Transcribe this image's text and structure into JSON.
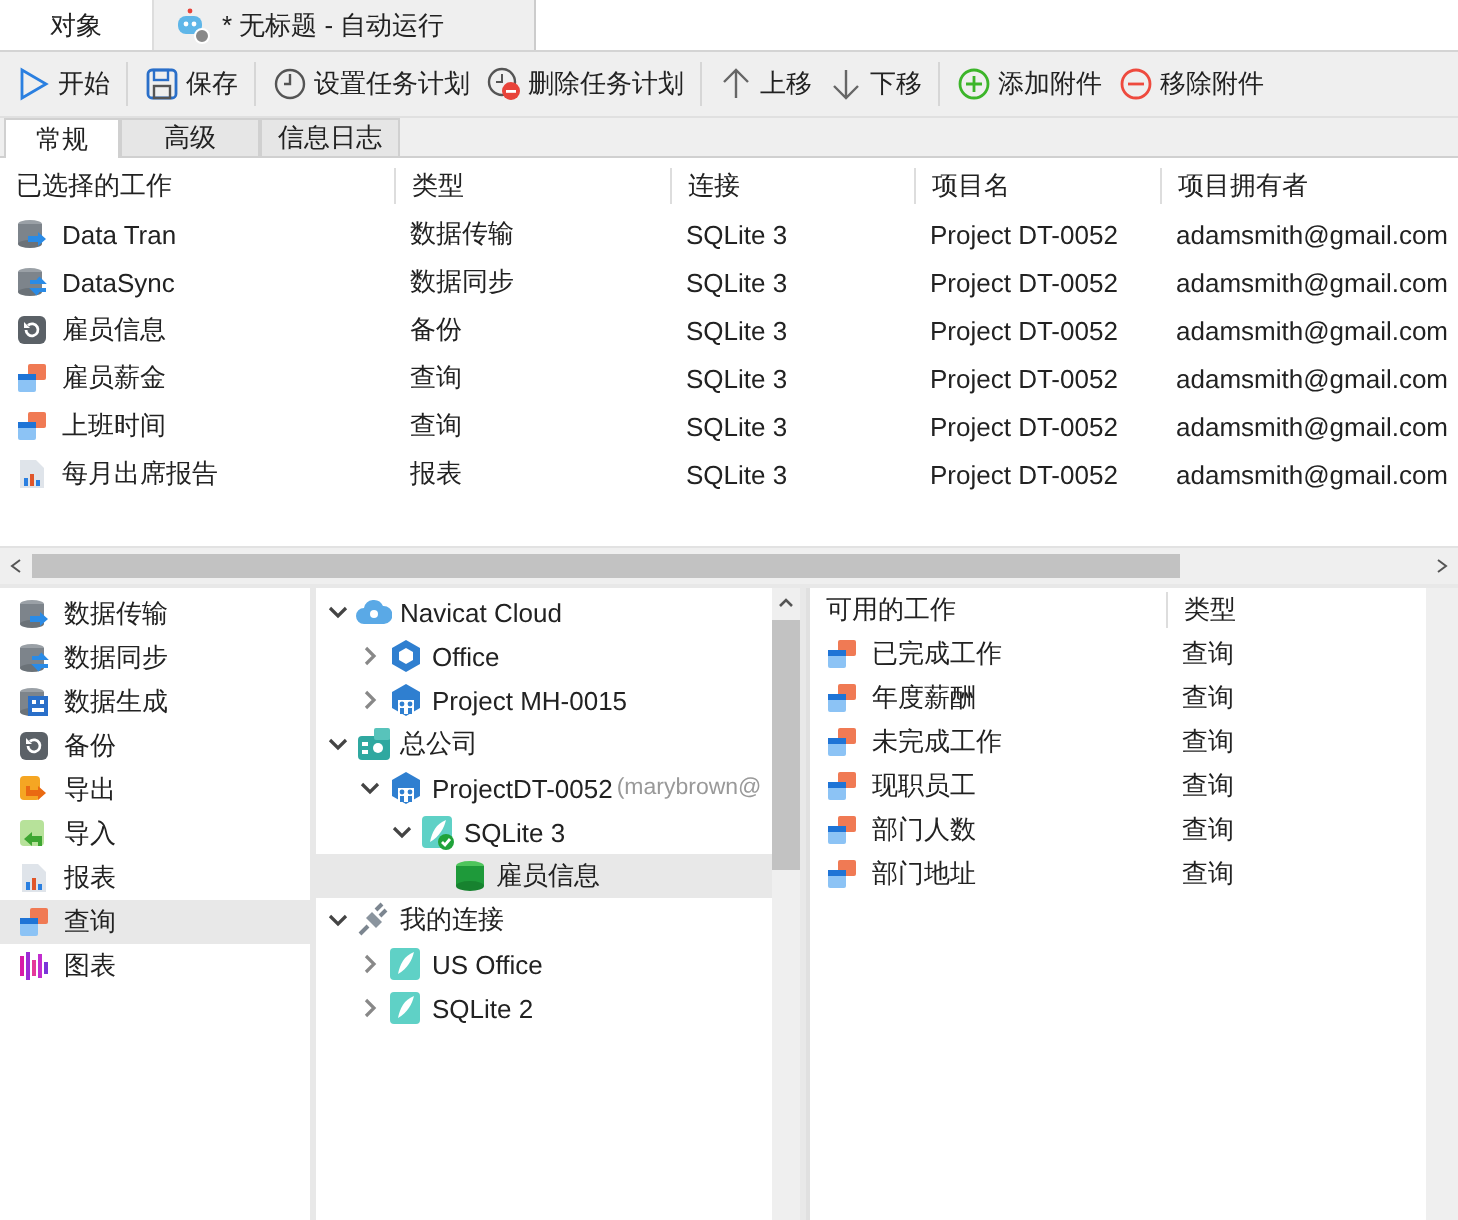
{
  "window_tabs": [
    {
      "label": "对象",
      "kind": "plain",
      "selected": false
    },
    {
      "label": "* 无标题 - 自动运行",
      "kind": "automation",
      "selected": true
    }
  ],
  "toolbar_groups": [
    {
      "buttons": [
        {
          "label": "开始",
          "kind": "start"
        }
      ]
    },
    {
      "buttons": [
        {
          "label": "保存",
          "kind": "save"
        }
      ]
    },
    {
      "buttons": [
        {
          "label": "设置任务计划",
          "kind": "schedule"
        },
        {
          "label": "删除任务计划",
          "kind": "unschedule"
        }
      ]
    },
    {
      "buttons": [
        {
          "label": "上移",
          "kind": "up"
        },
        {
          "label": "下移",
          "kind": "down"
        }
      ]
    },
    {
      "buttons": [
        {
          "label": "添加附件",
          "kind": "add"
        },
        {
          "label": "移除附件",
          "kind": "remove"
        }
      ]
    }
  ],
  "tabs": [
    {
      "label": "常规",
      "selected": true
    },
    {
      "label": "高级",
      "selected": false
    },
    {
      "label": "信息日志",
      "selected": false
    }
  ],
  "selected_jobs": {
    "columns": [
      "已选择的工作",
      "类型",
      "连接",
      "项目名",
      "项目拥有者"
    ],
    "rows": [
      {
        "kind": "transfer",
        "cells": [
          "Data Tran",
          "数据传输",
          "SQLite 3",
          "Project DT-0052",
          "adamsmith@gmail.com"
        ]
      },
      {
        "kind": "sync",
        "cells": [
          "DataSync",
          "数据同步",
          "SQLite 3",
          "Project DT-0052",
          "adamsmith@gmail.com"
        ]
      },
      {
        "kind": "backup",
        "cells": [
          "雇员信息",
          "备份",
          "SQLite 3",
          "Project DT-0052",
          "adamsmith@gmail.com"
        ]
      },
      {
        "kind": "query",
        "cells": [
          "雇员薪金",
          "查询",
          "SQLite 3",
          "Project DT-0052",
          "adamsmith@gmail.com"
        ]
      },
      {
        "kind": "query",
        "cells": [
          "上班时间",
          "查询",
          "SQLite 3",
          "Project DT-0052",
          "adamsmith@gmail.com"
        ]
      },
      {
        "kind": "report",
        "cells": [
          "每月出席报告",
          "报表",
          "SQLite 3",
          "Project DT-0052",
          "adamsmith@gmail.com"
        ]
      }
    ]
  },
  "job_types": [
    {
      "label": "数据传输",
      "kind": "transfer",
      "selected": false
    },
    {
      "label": "数据同步",
      "kind": "sync",
      "selected": false
    },
    {
      "label": "数据生成",
      "kind": "generate",
      "selected": false
    },
    {
      "label": "备份",
      "kind": "backup",
      "selected": false
    },
    {
      "label": "导出",
      "kind": "export",
      "selected": false
    },
    {
      "label": "导入",
      "kind": "import",
      "selected": false
    },
    {
      "label": "报表",
      "kind": "report",
      "selected": false
    },
    {
      "label": "查询",
      "kind": "query",
      "selected": true
    },
    {
      "label": "图表",
      "kind": "chart",
      "selected": false
    }
  ],
  "tree": [
    {
      "label": "Navicat Cloud",
      "kind": "cloud",
      "expanded": true,
      "selected": false,
      "children": [
        {
          "label": "Office",
          "kind": "project",
          "expanded": false,
          "selected": false
        },
        {
          "label": "Project MH-0015",
          "kind": "shared-project",
          "expanded": false,
          "selected": false
        }
      ]
    },
    {
      "label": "总公司",
      "kind": "server",
      "expanded": true,
      "selected": false,
      "children": [
        {
          "label": "ProjectDT-0052",
          "owner": "(marybrown@",
          "kind": "shared-project",
          "expanded": true,
          "selected": false,
          "children": [
            {
              "label": "SQLite 3",
              "kind": "connection-open",
              "expanded": true,
              "selected": false,
              "children": [
                {
                  "label": "雇员信息",
                  "kind": "database",
                  "selected": true
                }
              ]
            }
          ]
        }
      ]
    },
    {
      "label": "我的连接",
      "kind": "local",
      "expanded": true,
      "selected": false,
      "children": [
        {
          "label": "US Office",
          "kind": "connection",
          "expanded": false,
          "selected": false
        },
        {
          "label": "SQLite 2",
          "kind": "connection",
          "expanded": false,
          "selected": false
        }
      ]
    }
  ],
  "available_jobs": {
    "columns": [
      "可用的工作",
      "类型"
    ],
    "rows": [
      {
        "kind": "query",
        "cells": [
          "已完成工作",
          "查询"
        ]
      },
      {
        "kind": "query",
        "cells": [
          "年度薪酬",
          "查询"
        ]
      },
      {
        "kind": "query",
        "cells": [
          "未完成工作",
          "查询"
        ]
      },
      {
        "kind": "query",
        "cells": [
          "现职员工",
          "查询"
        ]
      },
      {
        "kind": "query",
        "cells": [
          "部门人数",
          "查询"
        ]
      },
      {
        "kind": "query",
        "cells": [
          "部门地址",
          "查询"
        ]
      }
    ]
  }
}
